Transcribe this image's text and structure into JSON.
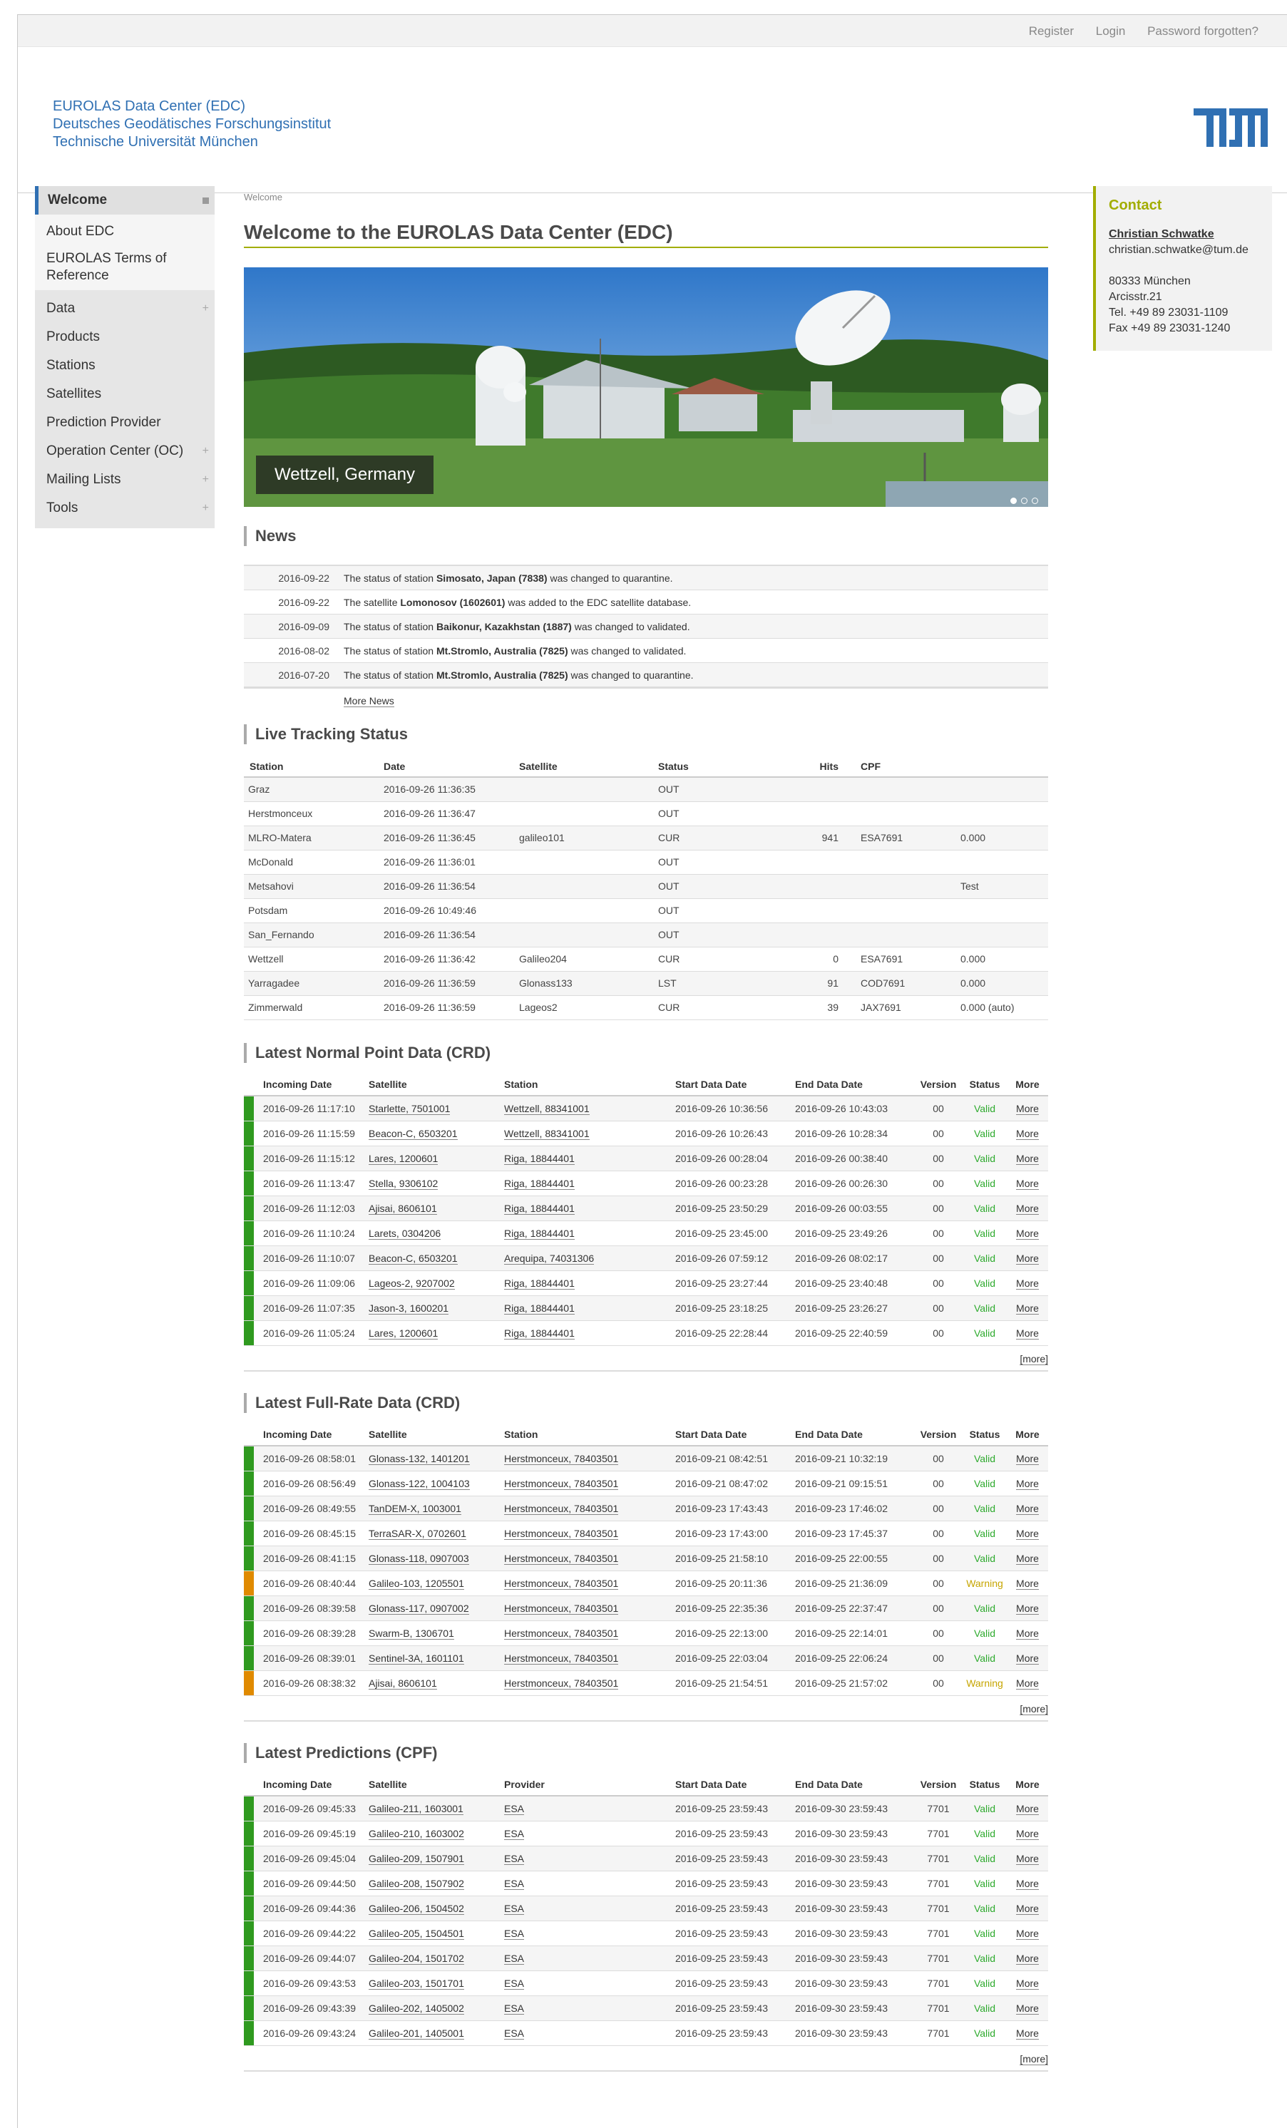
{
  "topbar": {
    "register": "Register",
    "login": "Login",
    "password": "Password forgotten?"
  },
  "org": {
    "line1": "EUROLAS Data Center (EDC)",
    "line2": "Deutsches Geodätisches Forschungsinstitut",
    "line3": "Technische Universität München"
  },
  "sidebar": {
    "welcome": "Welcome",
    "group1": [
      "About EDC",
      "EUROLAS Terms of Reference"
    ],
    "group2": [
      {
        "label": "Data",
        "expand": "+"
      },
      {
        "label": "Products",
        "expand": ""
      },
      {
        "label": "Stations",
        "expand": ""
      },
      {
        "label": "Satellites",
        "expand": ""
      },
      {
        "label": "Prediction Provider",
        "expand": ""
      },
      {
        "label": "Operation Center (OC)",
        "expand": "+"
      },
      {
        "label": "Mailing Lists",
        "expand": "+"
      },
      {
        "label": "Tools",
        "expand": "+"
      }
    ]
  },
  "breadcrumb": "Welcome",
  "page_title": "Welcome to the EUROLAS Data Center (EDC)",
  "hero": {
    "caption": "Wettzell, Germany"
  },
  "news": {
    "heading": "News",
    "items": [
      {
        "date": "2016-09-22",
        "pre": "The status of station ",
        "bold": "Simosato, Japan (7838)",
        "post": " was changed to quarantine."
      },
      {
        "date": "2016-09-22",
        "pre": "The satellite ",
        "bold": "Lomonosov (1602601)",
        "post": " was added to the EDC satellite database."
      },
      {
        "date": "2016-09-09",
        "pre": "The status of station ",
        "bold": "Baikonur, Kazakhstan (1887)",
        "post": " was changed to validated."
      },
      {
        "date": "2016-08-02",
        "pre": "The status of station ",
        "bold": "Mt.Stromlo, Australia (7825)",
        "post": " was changed to validated."
      },
      {
        "date": "2016-07-20",
        "pre": "The status of station ",
        "bold": "Mt.Stromlo, Australia (7825)",
        "post": " was changed to quarantine."
      }
    ],
    "more": "More News"
  },
  "live": {
    "heading": "Live Tracking Status",
    "columns": [
      "Station",
      "Date",
      "Satellite",
      "Status",
      "Hits",
      "CPF",
      ""
    ],
    "rows": [
      [
        "Graz",
        "2016-09-26 11:36:35",
        "",
        "OUT",
        "",
        "",
        ""
      ],
      [
        "Herstmonceux",
        "2016-09-26 11:36:47",
        "",
        "OUT",
        "",
        "",
        ""
      ],
      [
        "MLRO-Matera",
        "2016-09-26 11:36:45",
        "galileo101",
        "CUR",
        "941",
        "ESA7691",
        "0.000"
      ],
      [
        "McDonald",
        "2016-09-26 11:36:01",
        "",
        "OUT",
        "",
        "",
        ""
      ],
      [
        "Metsahovi",
        "2016-09-26 11:36:54",
        "",
        "OUT",
        "",
        "",
        "Test"
      ],
      [
        "Potsdam",
        "2016-09-26 10:49:46",
        "",
        "OUT",
        "",
        "",
        ""
      ],
      [
        "San_Fernando",
        "2016-09-26 11:36:54",
        "",
        "OUT",
        "",
        "",
        ""
      ],
      [
        "Wettzell",
        "2016-09-26 11:36:42",
        "Galileo204",
        "CUR",
        "0",
        "ESA7691",
        "0.000"
      ],
      [
        "Yarragadee",
        "2016-09-26 11:36:59",
        "Glonass133",
        "LST",
        "91",
        "COD7691",
        "0.000"
      ],
      [
        "Zimmerwald",
        "2016-09-26 11:36:59",
        "Lageos2",
        "CUR",
        "39",
        "JAX7691",
        "0.000 (auto)"
      ]
    ]
  },
  "npt": {
    "heading": "Latest Normal Point Data (CRD)",
    "columns": [
      "Incoming Date",
      "Satellite",
      "Station",
      "Start Data Date",
      "End Data Date",
      "Version",
      "Status",
      "More"
    ],
    "rows": [
      {
        "flag": "#2f9a1f",
        "c": [
          "2016-09-26 11:17:10",
          "Starlette, 7501001",
          "Wettzell, 88341001",
          "2016-09-26 10:36:56",
          "2016-09-26 10:43:03",
          "00",
          "Valid",
          "More"
        ]
      },
      {
        "flag": "#2f9a1f",
        "c": [
          "2016-09-26 11:15:59",
          "Beacon-C, 6503201",
          "Wettzell, 88341001",
          "2016-09-26 10:26:43",
          "2016-09-26 10:28:34",
          "00",
          "Valid",
          "More"
        ]
      },
      {
        "flag": "#2f9a1f",
        "c": [
          "2016-09-26 11:15:12",
          "Lares, 1200601",
          "Riga, 18844401",
          "2016-09-26 00:28:04",
          "2016-09-26 00:38:40",
          "00",
          "Valid",
          "More"
        ]
      },
      {
        "flag": "#2f9a1f",
        "c": [
          "2016-09-26 11:13:47",
          "Stella, 9306102",
          "Riga, 18844401",
          "2016-09-26 00:23:28",
          "2016-09-26 00:26:30",
          "00",
          "Valid",
          "More"
        ]
      },
      {
        "flag": "#2f9a1f",
        "c": [
          "2016-09-26 11:12:03",
          "Ajisai, 8606101",
          "Riga, 18844401",
          "2016-09-25 23:50:29",
          "2016-09-26 00:03:55",
          "00",
          "Valid",
          "More"
        ]
      },
      {
        "flag": "#2f9a1f",
        "c": [
          "2016-09-26 11:10:24",
          "Larets, 0304206",
          "Riga, 18844401",
          "2016-09-25 23:45:00",
          "2016-09-25 23:49:26",
          "00",
          "Valid",
          "More"
        ]
      },
      {
        "flag": "#2f9a1f",
        "c": [
          "2016-09-26 11:10:07",
          "Beacon-C, 6503201",
          "Arequipa, 74031306",
          "2016-09-26 07:59:12",
          "2016-09-26 08:02:17",
          "00",
          "Valid",
          "More"
        ]
      },
      {
        "flag": "#2f9a1f",
        "c": [
          "2016-09-26 11:09:06",
          "Lageos-2, 9207002",
          "Riga, 18844401",
          "2016-09-25 23:27:44",
          "2016-09-25 23:40:48",
          "00",
          "Valid",
          "More"
        ]
      },
      {
        "flag": "#2f9a1f",
        "c": [
          "2016-09-26 11:07:35",
          "Jason-3, 1600201",
          "Riga, 18844401",
          "2016-09-25 23:18:25",
          "2016-09-25 23:26:27",
          "00",
          "Valid",
          "More"
        ]
      },
      {
        "flag": "#2f9a1f",
        "c": [
          "2016-09-26 11:05:24",
          "Lares, 1200601",
          "Riga, 18844401",
          "2016-09-25 22:28:44",
          "2016-09-25 22:40:59",
          "00",
          "Valid",
          "More"
        ]
      }
    ],
    "more": "[more]"
  },
  "frd": {
    "heading": "Latest Full-Rate Data (CRD)",
    "columns": [
      "Incoming Date",
      "Satellite",
      "Station",
      "Start Data Date",
      "End Data Date",
      "Version",
      "Status",
      "More"
    ],
    "rows": [
      {
        "flag": "#2f9a1f",
        "c": [
          "2016-09-26 08:58:01",
          "Glonass-132, 1401201",
          "Herstmonceux, 78403501",
          "2016-09-21 08:42:51",
          "2016-09-21 10:32:19",
          "00",
          "Valid",
          "More"
        ]
      },
      {
        "flag": "#2f9a1f",
        "c": [
          "2016-09-26 08:56:49",
          "Glonass-122, 1004103",
          "Herstmonceux, 78403501",
          "2016-09-21 08:47:02",
          "2016-09-21 09:15:51",
          "00",
          "Valid",
          "More"
        ]
      },
      {
        "flag": "#2f9a1f",
        "c": [
          "2016-09-26 08:49:55",
          "TanDEM-X, 1003001",
          "Herstmonceux, 78403501",
          "2016-09-23 17:43:43",
          "2016-09-23 17:46:02",
          "00",
          "Valid",
          "More"
        ]
      },
      {
        "flag": "#2f9a1f",
        "c": [
          "2016-09-26 08:45:15",
          "TerraSAR-X, 0702601",
          "Herstmonceux, 78403501",
          "2016-09-23 17:43:00",
          "2016-09-23 17:45:37",
          "00",
          "Valid",
          "More"
        ]
      },
      {
        "flag": "#2f9a1f",
        "c": [
          "2016-09-26 08:41:15",
          "Glonass-118, 0907003",
          "Herstmonceux, 78403501",
          "2016-09-25 21:58:10",
          "2016-09-25 22:00:55",
          "00",
          "Valid",
          "More"
        ]
      },
      {
        "flag": "#e08a00",
        "c": [
          "2016-09-26 08:40:44",
          "Galileo-103, 1205501",
          "Herstmonceux, 78403501",
          "2016-09-25 20:11:36",
          "2016-09-25 21:36:09",
          "00",
          "Warning",
          "More"
        ]
      },
      {
        "flag": "#2f9a1f",
        "c": [
          "2016-09-26 08:39:58",
          "Glonass-117, 0907002",
          "Herstmonceux, 78403501",
          "2016-09-25 22:35:36",
          "2016-09-25 22:37:47",
          "00",
          "Valid",
          "More"
        ]
      },
      {
        "flag": "#2f9a1f",
        "c": [
          "2016-09-26 08:39:28",
          "Swarm-B, 1306701",
          "Herstmonceux, 78403501",
          "2016-09-25 22:13:00",
          "2016-09-25 22:14:01",
          "00",
          "Valid",
          "More"
        ]
      },
      {
        "flag": "#2f9a1f",
        "c": [
          "2016-09-26 08:39:01",
          "Sentinel-3A, 1601101",
          "Herstmonceux, 78403501",
          "2016-09-25 22:03:04",
          "2016-09-25 22:06:24",
          "00",
          "Valid",
          "More"
        ]
      },
      {
        "flag": "#e08a00",
        "c": [
          "2016-09-26 08:38:32",
          "Ajisai, 8606101",
          "Herstmonceux, 78403501",
          "2016-09-25 21:54:51",
          "2016-09-25 21:57:02",
          "00",
          "Warning",
          "More"
        ]
      }
    ],
    "more": "[more]"
  },
  "cpf": {
    "heading": "Latest Predictions (CPF)",
    "columns": [
      "Incoming Date",
      "Satellite",
      "Provider",
      "Start Data Date",
      "End Data Date",
      "Version",
      "Status",
      "More"
    ],
    "rows": [
      {
        "flag": "#2f9a1f",
        "c": [
          "2016-09-26 09:45:33",
          "Galileo-211, 1603001",
          "ESA",
          "2016-09-25 23:59:43",
          "2016-09-30 23:59:43",
          "7701",
          "Valid",
          "More"
        ]
      },
      {
        "flag": "#2f9a1f",
        "c": [
          "2016-09-26 09:45:19",
          "Galileo-210, 1603002",
          "ESA",
          "2016-09-25 23:59:43",
          "2016-09-30 23:59:43",
          "7701",
          "Valid",
          "More"
        ]
      },
      {
        "flag": "#2f9a1f",
        "c": [
          "2016-09-26 09:45:04",
          "Galileo-209, 1507901",
          "ESA",
          "2016-09-25 23:59:43",
          "2016-09-30 23:59:43",
          "7701",
          "Valid",
          "More"
        ]
      },
      {
        "flag": "#2f9a1f",
        "c": [
          "2016-09-26 09:44:50",
          "Galileo-208, 1507902",
          "ESA",
          "2016-09-25 23:59:43",
          "2016-09-30 23:59:43",
          "7701",
          "Valid",
          "More"
        ]
      },
      {
        "flag": "#2f9a1f",
        "c": [
          "2016-09-26 09:44:36",
          "Galileo-206, 1504502",
          "ESA",
          "2016-09-25 23:59:43",
          "2016-09-30 23:59:43",
          "7701",
          "Valid",
          "More"
        ]
      },
      {
        "flag": "#2f9a1f",
        "c": [
          "2016-09-26 09:44:22",
          "Galileo-205, 1504501",
          "ESA",
          "2016-09-25 23:59:43",
          "2016-09-30 23:59:43",
          "7701",
          "Valid",
          "More"
        ]
      },
      {
        "flag": "#2f9a1f",
        "c": [
          "2016-09-26 09:44:07",
          "Galileo-204, 1501702",
          "ESA",
          "2016-09-25 23:59:43",
          "2016-09-30 23:59:43",
          "7701",
          "Valid",
          "More"
        ]
      },
      {
        "flag": "#2f9a1f",
        "c": [
          "2016-09-26 09:43:53",
          "Galileo-203, 1501701",
          "ESA",
          "2016-09-25 23:59:43",
          "2016-09-30 23:59:43",
          "7701",
          "Valid",
          "More"
        ]
      },
      {
        "flag": "#2f9a1f",
        "c": [
          "2016-09-26 09:43:39",
          "Galileo-202, 1405002",
          "ESA",
          "2016-09-25 23:59:43",
          "2016-09-30 23:59:43",
          "7701",
          "Valid",
          "More"
        ]
      },
      {
        "flag": "#2f9a1f",
        "c": [
          "2016-09-26 09:43:24",
          "Galileo-201, 1405001",
          "ESA",
          "2016-09-25 23:59:43",
          "2016-09-30 23:59:43",
          "7701",
          "Valid",
          "More"
        ]
      }
    ],
    "more": "[more]"
  },
  "contact": {
    "heading": "Contact",
    "name": "Christian Schwatke",
    "email": "christian.schwatke@tum.de",
    "city": "80333 München",
    "street": "Arcisstr.21",
    "tel": "Tel. +49 89 23031-1109",
    "fax": "Fax +49 89 23031-1240"
  },
  "colors": {
    "accent": "#3070b3",
    "olive": "#a2ad00",
    "valid": "#2eaa2e",
    "warning": "#c6a500"
  }
}
